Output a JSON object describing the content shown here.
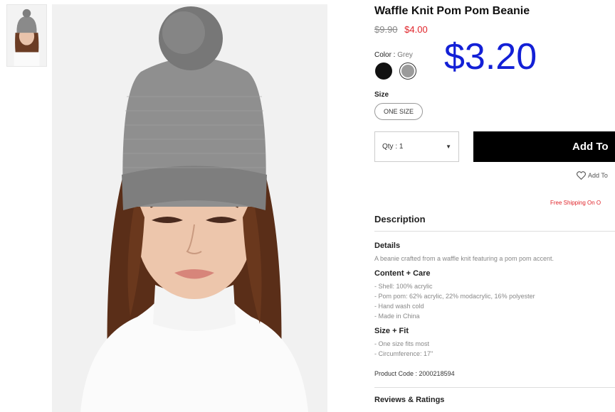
{
  "product": {
    "title": "Waffle Knit Pom Pom Beanie",
    "price_original": "$9.90",
    "price_sale": "$4.00",
    "price_overlay": "$3.20",
    "color_label": "Color :",
    "color_value": "Grey",
    "colors": [
      {
        "name": "black",
        "hex": "#111111"
      },
      {
        "name": "grey",
        "hex": "#9b9b9b"
      }
    ],
    "size_label": "Size",
    "size_option": "ONE SIZE",
    "qty_label": "Qty : 1",
    "add_button": "Add To",
    "wishlist_label": "Add To",
    "free_shipping": "Free Shipping On O"
  },
  "description": {
    "heading": "Description",
    "details_heading": "Details",
    "details_text": "A beanie crafted from a waffle knit featuring a pom pom accent.",
    "content_heading": "Content + Care",
    "content_lines": [
      "- Shell: 100% acrylic",
      "- Pom pom: 62% acrylic, 22% modacrylic, 16% polyester",
      "- Hand wash cold",
      "- Made in China"
    ],
    "sizefit_heading": "Size + Fit",
    "sizefit_lines": [
      "- One size fits most",
      "- Circumference: 17\""
    ],
    "product_code": "Product Code : 2000218594"
  },
  "reviews": {
    "heading": "Reviews & Ratings"
  },
  "colors": {
    "sale_red": "#e0242a",
    "overlay_blue": "#1320d6",
    "button_black": "#000000"
  }
}
